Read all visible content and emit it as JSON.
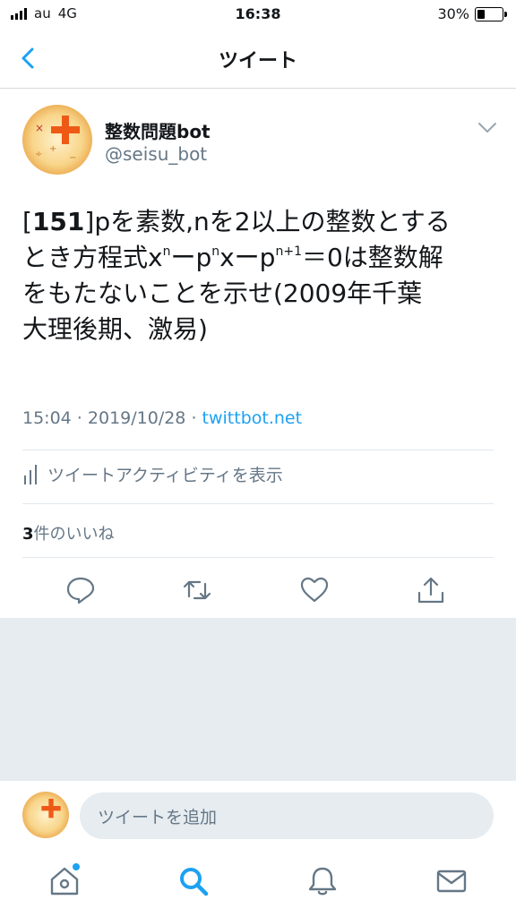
{
  "status_bar": {
    "carrier": "au",
    "network": "4G",
    "time": "16:38",
    "battery": "30%"
  },
  "header": {
    "title": "ツイート"
  },
  "tweet": {
    "user_name": "整数問題bot",
    "handle": "@seisu_bot",
    "text": {
      "line1_num": "151",
      "line1_bracket_open": "[",
      "line1_rest": "]pを素数,nを2以上の整数とする",
      "line2_a": "とき方程式x",
      "sup_n1": "n",
      "line2_b": "ーp",
      "sup_n2": "n",
      "line2_c": "xーp",
      "sup_n3": "n+1",
      "line2_d": "＝0は整数解",
      "line3": "をもたないことを示せ(2009年千葉",
      "line4": "大理後期、激易)"
    },
    "time": "15:04",
    "date": "2019/10/28",
    "separator": " · ",
    "source": "twittbot.net",
    "activity_label": "ツイートアクティビティを表示",
    "like_count": "3",
    "like_suffix": "件のいいね"
  },
  "reply": {
    "placeholder": "ツイートを追加"
  },
  "icons": {
    "back": "chevron-left-icon",
    "caret": "chevron-down-icon",
    "activity": "bar-chart-icon",
    "reply": "comment-icon",
    "retweet": "retweet-icon",
    "like": "heart-icon",
    "share": "share-icon",
    "home": "home-icon",
    "search": "search-icon",
    "notifications": "bell-icon",
    "messages": "mail-icon"
  },
  "colors": {
    "accent": "#1da1f2",
    "secondary_text": "#657786",
    "divider": "#e1e8ed",
    "grey_area": "#e6ecf0"
  }
}
